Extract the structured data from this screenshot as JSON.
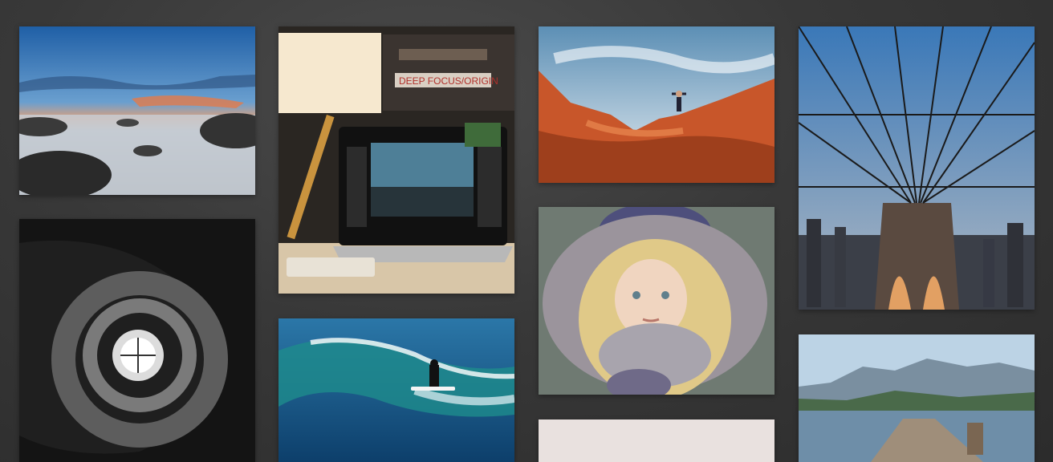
{
  "gallery": {
    "photos": [
      {
        "subject": "seascape-rocks-sunset"
      },
      {
        "subject": "spiral-staircase"
      },
      {
        "subject": "laptop-desk-lamp",
        "book_label": "DEEP FOCUS/ORIGIN"
      },
      {
        "subject": "surfer-wave"
      },
      {
        "subject": "hiker-red-rocks"
      },
      {
        "subject": "girl-fur-hood"
      },
      {
        "subject": "blank-pale"
      },
      {
        "subject": "brooklyn-bridge-cables"
      },
      {
        "subject": "lake-dock-mountains"
      }
    ]
  },
  "colors": {
    "background": "#3a3a3a",
    "sky_blue": "#3a78b8",
    "rock_orange": "#c8562a",
    "ocean_teal": "#1e6e8c"
  }
}
